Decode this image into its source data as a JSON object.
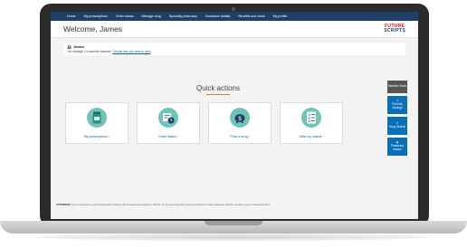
{
  "nav": {
    "items": [
      "Home",
      "My prescriptions",
      "Order status",
      "Manage drug",
      "Specialty pharmacy",
      "Insurance details",
      "Benefits and costs",
      "My profile"
    ]
  },
  "header": {
    "welcome": "Welcome, James",
    "logo_line1": "FUTURE",
    "logo_line2": "SCRIPTS"
  },
  "member": {
    "name": "James",
    "subtext_prefix": "You manage 1 household member.",
    "subtext_link": "Choose who you want to view"
  },
  "quick_actions": {
    "title": "Quick actions",
    "cards": [
      {
        "label": "My prescriptions ›",
        "icon": "prescription-bottle-icon"
      },
      {
        "label": "Order status ›",
        "icon": "order-box-clock-icon"
      },
      {
        "label": "Price a drug ›",
        "icon": "piggy-bank-icon"
      },
      {
        "label": "View my claims ›",
        "icon": "claims-checklist-icon"
      }
    ]
  },
  "side_tabs": [
    {
      "label": "Member Tools",
      "icon": ""
    },
    {
      "label": "Find My Savings",
      "icon": "search-icon"
    },
    {
      "label": "Drug Search",
      "icon": "search-icon"
    },
    {
      "label": "Pharmacy locator",
      "icon": "location-pin-icon"
    }
  ],
  "footer": {
    "bold": "ATTENTION",
    "text": "If you or someone in your household is having a life threatening emergency, call 911. If you need help with your prescriptions or have questions, call the number on your member ID card."
  },
  "colors": {
    "nav_bg": "#1f3f6b",
    "accent_teal": "#6fc3b8",
    "link_blue": "#0b5cad",
    "tab_blue": "#0b6fb8",
    "brand_red": "#c8102e"
  }
}
